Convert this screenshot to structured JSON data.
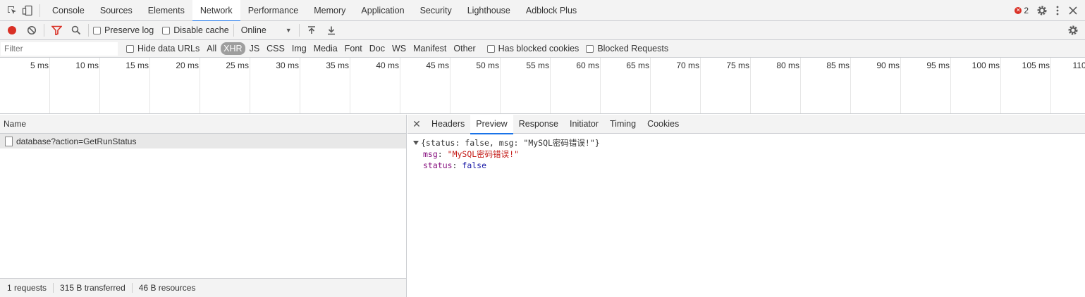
{
  "main_tabs": [
    "Console",
    "Sources",
    "Elements",
    "Network",
    "Performance",
    "Memory",
    "Application",
    "Security",
    "Lighthouse",
    "Adblock Plus"
  ],
  "error_count": "2",
  "toolbar": {
    "preserve_log": "Preserve log",
    "disable_cache": "Disable cache",
    "throttle": "Online"
  },
  "filter": {
    "placeholder": "Filter",
    "hide_data_urls": "Hide data URLs",
    "types": [
      "All",
      "XHR",
      "JS",
      "CSS",
      "Img",
      "Media",
      "Font",
      "Doc",
      "WS",
      "Manifest",
      "Other"
    ],
    "selected_type": "XHR",
    "has_blocked_cookies": "Has blocked cookies",
    "blocked_requests": "Blocked Requests"
  },
  "timeline_ticks": [
    "5 ms",
    "10 ms",
    "15 ms",
    "20 ms",
    "25 ms",
    "30 ms",
    "35 ms",
    "40 ms",
    "45 ms",
    "50 ms",
    "55 ms",
    "60 ms",
    "65 ms",
    "70 ms",
    "75 ms",
    "80 ms",
    "85 ms",
    "90 ms",
    "95 ms",
    "100 ms",
    "105 ms",
    "110 ms"
  ],
  "requests": {
    "column_name": "Name",
    "items": [
      "database?action=GetRunStatus"
    ]
  },
  "status_bar": {
    "requests": "1 requests",
    "transferred": "315 B transferred",
    "resources": "46 B resources"
  },
  "detail_tabs": [
    "Headers",
    "Preview",
    "Response",
    "Initiator",
    "Timing",
    "Cookies"
  ],
  "preview": {
    "summary": "{status: false, msg: \"MySQL密码错误!\"}",
    "msg_key": "msg",
    "msg_value": "\"MySQL密码错误!\"",
    "status_key": "status",
    "status_value": "false"
  },
  "colors": {
    "accent": "#1a73e8",
    "record": "#d93025",
    "filter_icon": "#d93025"
  }
}
